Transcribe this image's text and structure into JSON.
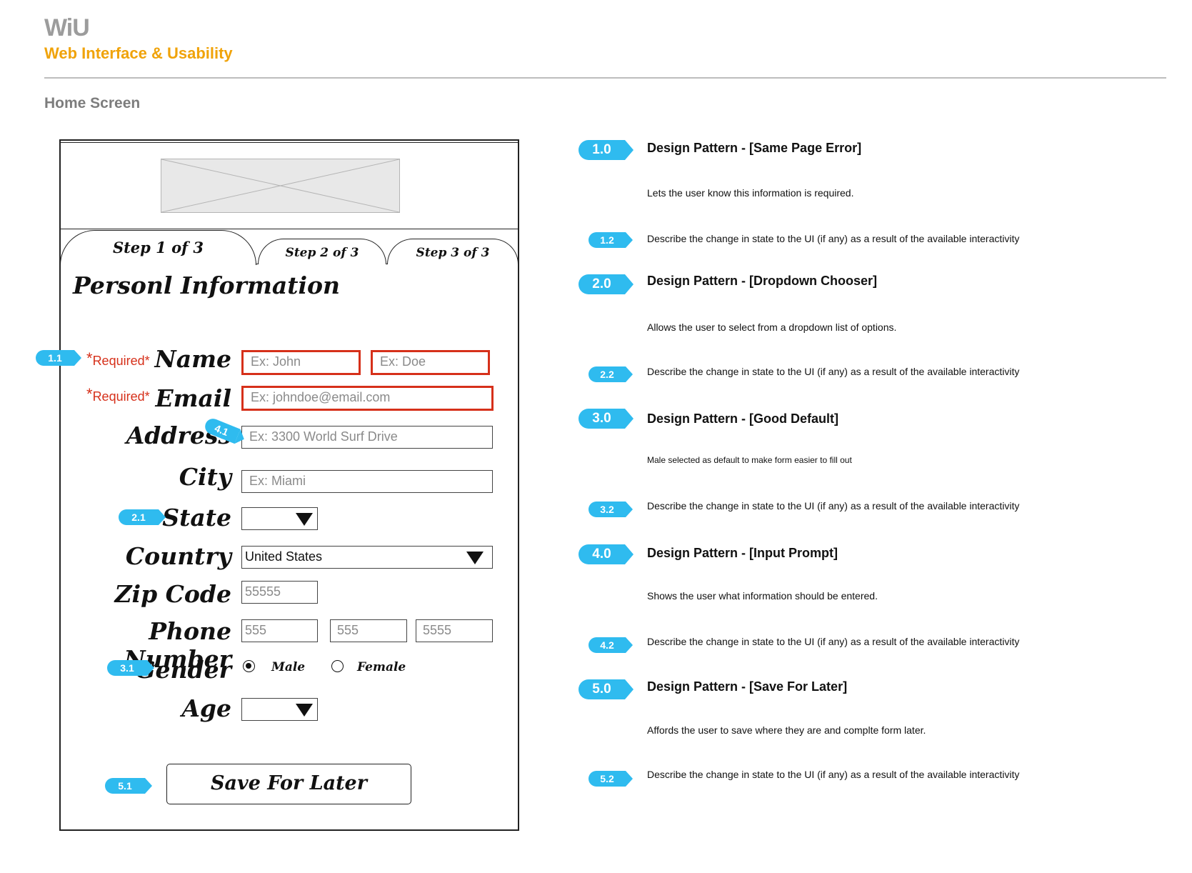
{
  "header": {
    "brand": "WiU",
    "subtitle": "Web Interface & Usability",
    "screen_title": "Home Screen"
  },
  "form": {
    "tabs": [
      "Step 1 of 3",
      "Step 2 of 3",
      "Step 3 of 3"
    ],
    "title": "Personl Information",
    "required_label": "Required*",
    "required_star": "*",
    "labels": {
      "name": "Name",
      "email": "Email",
      "address": "Address",
      "city": "City",
      "state": "State",
      "country": "Country",
      "zip": "Zip Code",
      "phone": "Phone Number",
      "gender": "Gender",
      "age": "Age"
    },
    "placeholders": {
      "first_name": "Ex: John",
      "last_name": "Ex: Doe",
      "email": "Ex: johndoe@email.com",
      "address": "Ex: 3300 World Surf Drive",
      "city": "Ex: Miami",
      "zip": "55555",
      "phone_1": "555",
      "phone_2": "555",
      "phone_3": "5555"
    },
    "country_value": "United States",
    "gender_options": [
      "Male",
      "Female"
    ],
    "gender_selected": "Male",
    "save_button": "Save For Later"
  },
  "markers": {
    "m1_1": "1.1",
    "m2_1": "2.1",
    "m3_1": "3.1",
    "m4_1": "4.1",
    "m5_1": "5.1"
  },
  "annotations": [
    {
      "num": "1.0",
      "title": "Design Pattern - [Same Page Error]",
      "desc": "Lets the user know this information is required.",
      "sub_num": "1.2",
      "sub_desc": "Describe the change in state to the UI (if any) as a result of the available interactivity"
    },
    {
      "num": "2.0",
      "title": "Design Pattern - [Dropdown Chooser]",
      "desc": "Allows the user to select from a dropdown list of options.",
      "sub_num": "2.2",
      "sub_desc": "Describe the change in state to the UI (if any) as a result of the available interactivity"
    },
    {
      "num": "3.0",
      "title": "Design Pattern - [Good Default]",
      "desc": "Male selected as default to make form easier to fill out",
      "sub_num": "3.2",
      "sub_desc": "Describe the change in state to the UI (if any) as a result of the available interactivity"
    },
    {
      "num": "4.0",
      "title": "Design Pattern - [Input Prompt]",
      "desc": "Shows the user what information should be entered.",
      "sub_num": "4.2",
      "sub_desc": "Describe the change in state to the UI (if any) as a result of the available interactivity"
    },
    {
      "num": "5.0",
      "title": "Design Pattern - [Save For Later]",
      "desc": "Affords the user to save where they are and complte form later.",
      "sub_num": "5.2",
      "sub_desc": "Describe the change in state to the UI (if any) as a result of the available interactivity"
    }
  ],
  "colors": {
    "accent_orange": "#f0a30a",
    "marker_blue": "#2fbbef",
    "error_red": "#d6301a",
    "brand_gray": "#9c9c9c"
  }
}
